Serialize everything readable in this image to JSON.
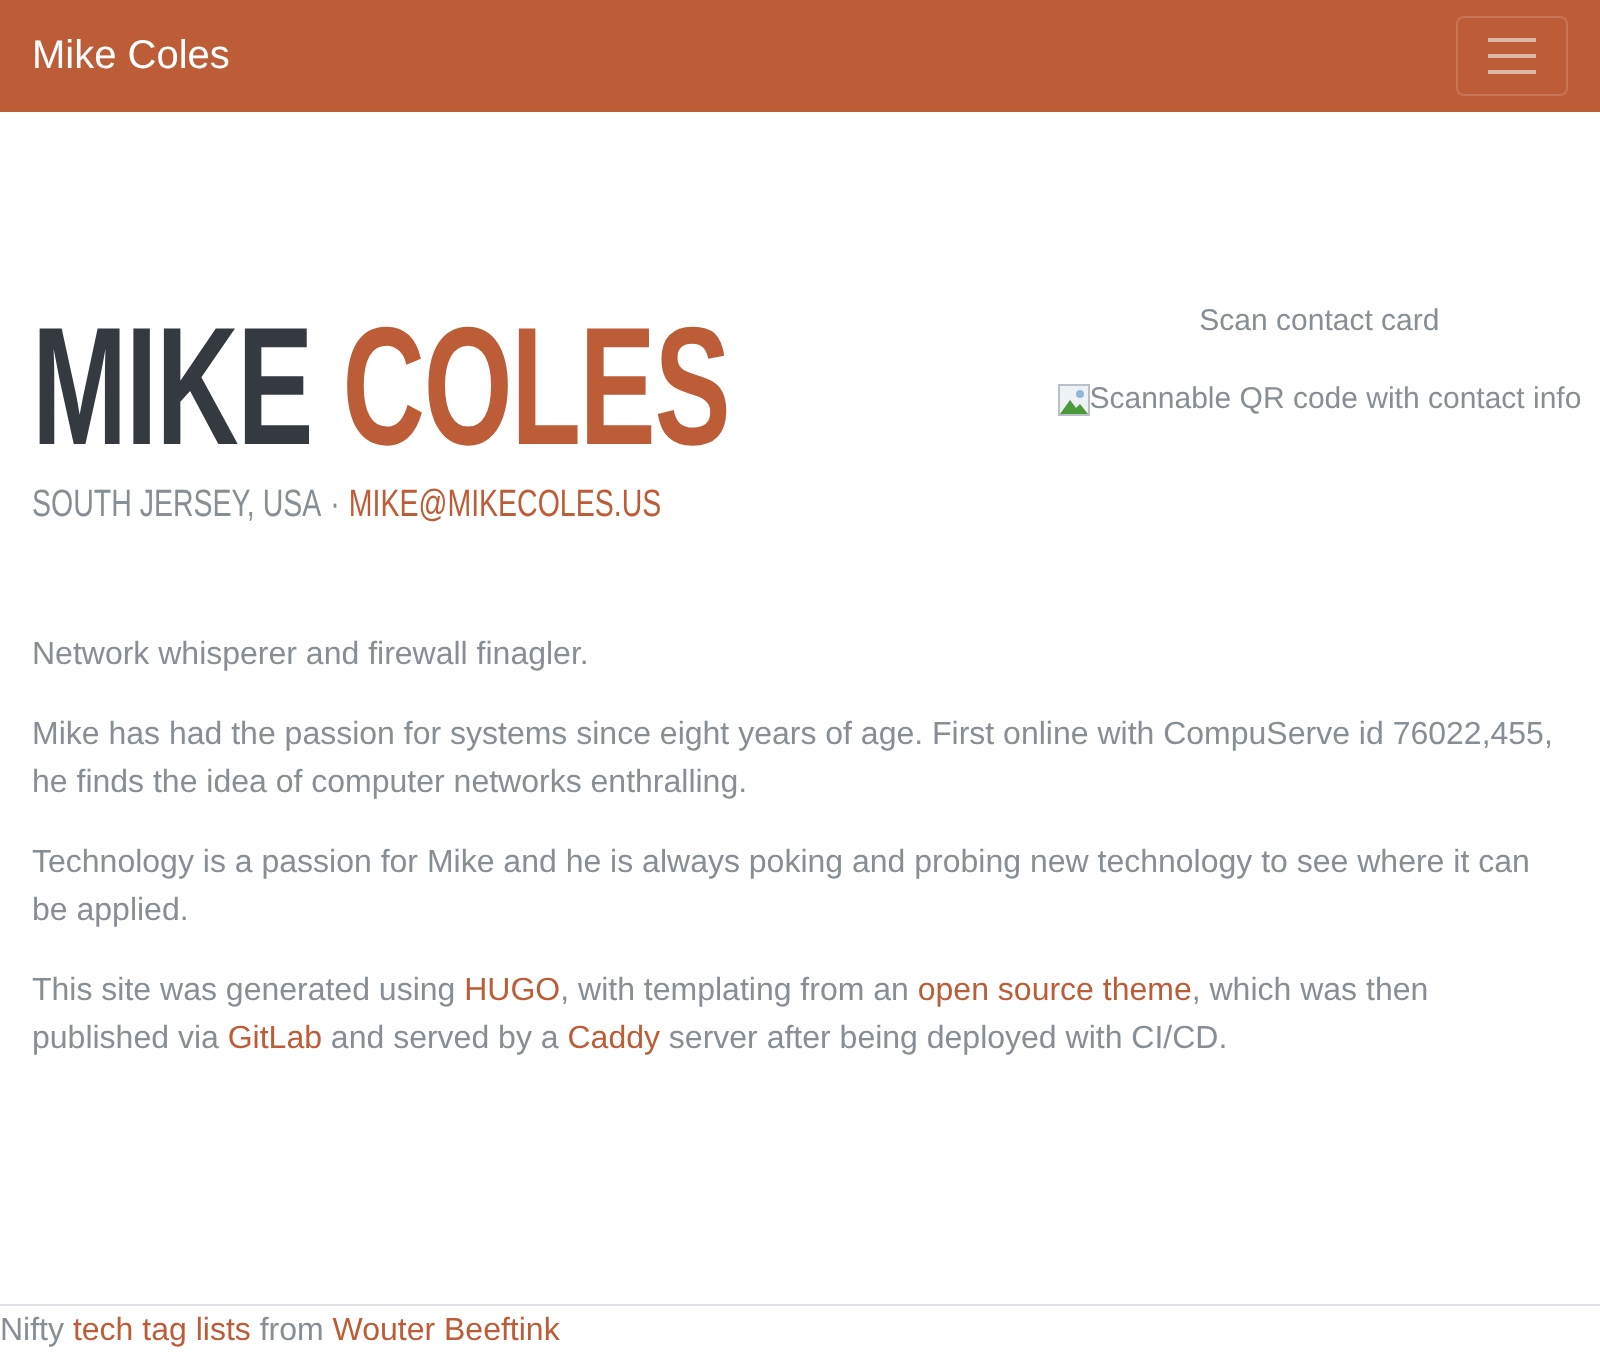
{
  "navbar": {
    "brand": "Mike Coles"
  },
  "hero": {
    "first_name": "MIKE",
    "last_name": "COLES",
    "location": "SOUTH JERSEY, USA",
    "separator": "·",
    "email": "MIKE@MIKECOLES.US"
  },
  "contact_card": {
    "caption": "Scan contact card",
    "image_alt": "Scannable QR code with contact info"
  },
  "paragraphs": [
    [
      {
        "kind": "text",
        "text": "Network whisperer and firewall finagler."
      }
    ],
    [
      {
        "kind": "text",
        "text": "Mike has had the passion for systems since eight years of age. First online with CompuServe id 76022,455, he finds the idea of computer networks enthralling."
      }
    ],
    [
      {
        "kind": "text",
        "text": "Technology is a passion for Mike and he is always poking and probing new technology to see where it can be applied."
      }
    ],
    [
      {
        "kind": "text",
        "text": "This site was generated using "
      },
      {
        "kind": "link",
        "text": "HUGO"
      },
      {
        "kind": "text",
        "text": ", with templating from an "
      },
      {
        "kind": "link",
        "text": "open source theme"
      },
      {
        "kind": "text",
        "text": ", which was then published via "
      },
      {
        "kind": "link",
        "text": "GitLab"
      },
      {
        "kind": "text",
        "text": " and served by a "
      },
      {
        "kind": "link",
        "text": "Caddy"
      },
      {
        "kind": "text",
        "text": " server after being deployed with CI/CD."
      }
    ]
  ],
  "footer": [
    {
      "kind": "text",
      "text": "Nifty "
    },
    {
      "kind": "link",
      "text": "tech tag lists"
    },
    {
      "kind": "text",
      "text": " from "
    },
    {
      "kind": "link",
      "text": "Wouter Beeftink"
    }
  ]
}
